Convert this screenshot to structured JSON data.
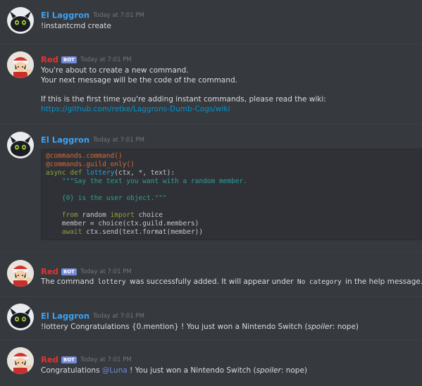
{
  "users": {
    "laggron": {
      "name": "El Laggron",
      "color": "#3ea2f2"
    },
    "red": {
      "name": "Red",
      "badge": "BOT",
      "color": "#e63232"
    }
  },
  "messages": [
    {
      "author": "El Laggron",
      "timestamp": "Today at 7:01 PM",
      "lines": [
        "!instantcmd create"
      ]
    },
    {
      "author": "Red",
      "badge": "BOT",
      "timestamp": "Today at 7:01 PM",
      "lines": [
        "You're about to create a new command.",
        "Your next message will be the code of the command.",
        "If this is the first time you're adding instant commands, please read the wiki:"
      ],
      "link": "https://github.com/retke/Laggrons-Dumb-Cogs/wiki"
    },
    {
      "author": "El Laggron",
      "timestamp": "Today at 7:01 PM",
      "code": {
        "decorator1": "@commands.command()",
        "decorator2": "@commands.guild_only()",
        "kw_async": "async",
        "kw_def": "def",
        "func_name": "lottery",
        "signature": "(ctx, *, text):",
        "doc1": "\"\"\"Say the text you want with a random member.",
        "doc2": "{0} is the user object.\"\"\"",
        "kw_from": "from",
        "import_module": "random",
        "kw_import": "import",
        "import_name": "choice",
        "line_member": "member = choice(ctx.guild.members)",
        "kw_await": "await",
        "line_send": "ctx.send(text.format(member))"
      }
    },
    {
      "author": "Red",
      "badge": "BOT",
      "timestamp": "Today at 7:01 PM",
      "parts": {
        "before": "The command",
        "code1": "lottery",
        "middle": "was successfully added. It will appear under",
        "code2": "No category",
        "after": "in the help message."
      }
    },
    {
      "author": "El Laggron",
      "timestamp": "Today at 7:01 PM",
      "parts": {
        "before": "!lottery Congratulations {0.mention} ! You just won a Nintendo Switch (",
        "em": "spoiler",
        "after": ": nope)"
      }
    },
    {
      "author": "Red",
      "badge": "BOT",
      "timestamp": "Today at 7:01 PM",
      "parts": {
        "before": "Congratulations",
        "mention": "@Luna",
        "middle": "! You just won a Nintendo Switch (",
        "em": "spoiler",
        "after": ": nope)"
      }
    }
  ]
}
